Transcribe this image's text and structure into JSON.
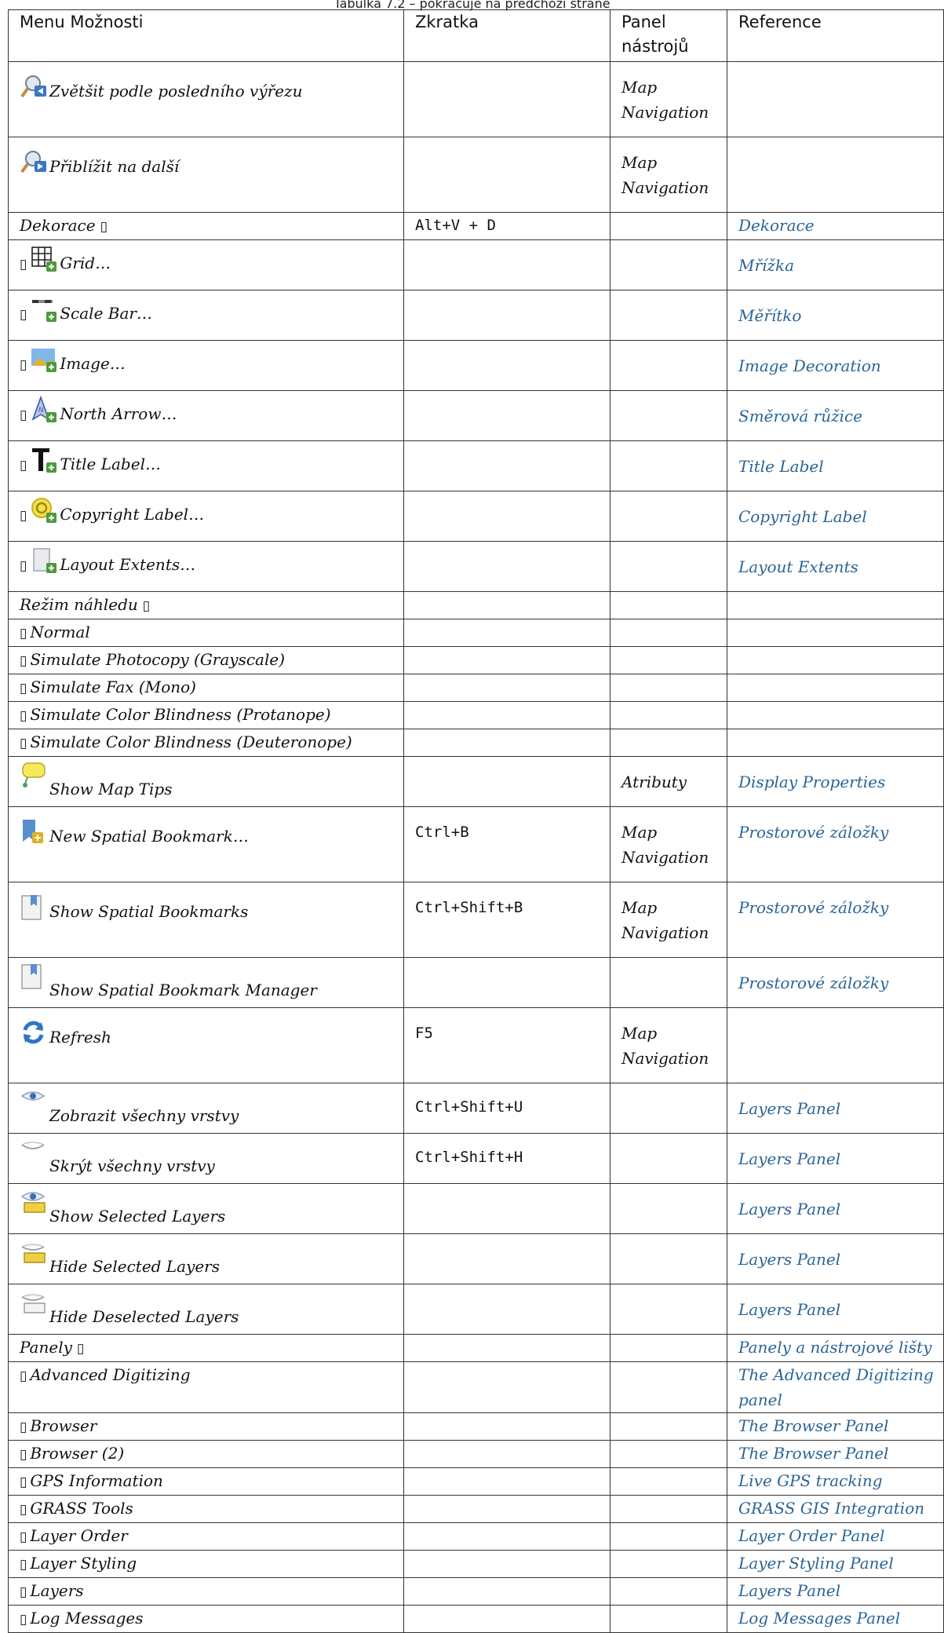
{
  "caption": "Tabulka 7.2 – pokračuje na předchozí straně",
  "headers": [
    "Menu Možnosti",
    "Zkratka",
    "Panel nástrojů",
    "Reference"
  ],
  "rows": [
    {
      "label": "Zvětšit podle posledního výřezu",
      "icon": "zoom-last-icon",
      "shortcut": "",
      "toolbar": "Map Navigation",
      "reference": ""
    },
    {
      "label": "Přiblížit na další",
      "icon": "zoom-next-icon",
      "shortcut": "",
      "toolbar": "Map Navigation",
      "reference": ""
    },
    {
      "label": "Dekorace",
      "suffix": "▯",
      "shortcut": "Alt+V + D",
      "toolbar": "",
      "reference": "Dekorace"
    },
    {
      "label": "Grid…",
      "prefix": "▯",
      "icon": "grid-add-icon",
      "shortcut": "",
      "toolbar": "",
      "reference": "Mřížka"
    },
    {
      "label": "Scale Bar…",
      "prefix": "▯",
      "icon": "scalebar-add-icon",
      "shortcut": "",
      "toolbar": "",
      "reference": "Měřítko"
    },
    {
      "label": "Image…",
      "prefix": "▯",
      "icon": "image-add-icon",
      "shortcut": "",
      "toolbar": "",
      "reference": "Image Decoration"
    },
    {
      "label": "North Arrow…",
      "prefix": "▯",
      "icon": "north-arrow-add-icon",
      "shortcut": "",
      "toolbar": "",
      "reference": "Směrová růžice"
    },
    {
      "label": "Title Label…",
      "prefix": "▯",
      "icon": "title-label-add-icon",
      "shortcut": "",
      "toolbar": "",
      "reference": "Title Label"
    },
    {
      "label": "Copyright Label…",
      "prefix": "▯",
      "icon": "copyright-add-icon",
      "shortcut": "",
      "toolbar": "",
      "reference": "Copyright Label"
    },
    {
      "label": "Layout Extents…",
      "prefix": "▯",
      "icon": "layout-extents-add-icon",
      "shortcut": "",
      "toolbar": "",
      "reference": "Layout Extents"
    },
    {
      "label": "Režim náhledu",
      "suffix": "▯",
      "shortcut": "",
      "toolbar": "",
      "reference": ""
    },
    {
      "label": "Normal",
      "prefix": "▯",
      "shortcut": "",
      "toolbar": "",
      "reference": ""
    },
    {
      "label": "Simulate Photocopy (Grayscale)",
      "prefix": "▯",
      "shortcut": "",
      "toolbar": "",
      "reference": ""
    },
    {
      "label": "Simulate Fax (Mono)",
      "prefix": "▯",
      "shortcut": "",
      "toolbar": "",
      "reference": ""
    },
    {
      "label": "Simulate Color Blindness (Protanope)",
      "prefix": "▯",
      "shortcut": "",
      "toolbar": "",
      "reference": ""
    },
    {
      "label": "Simulate Color Blindness (Deuteronope)",
      "prefix": "▯",
      "shortcut": "",
      "toolbar": "",
      "reference": ""
    },
    {
      "label": "Show Map Tips",
      "icon": "map-tips-icon",
      "shortcut": "",
      "toolbar": "Atributy",
      "reference": "Display Properties"
    },
    {
      "label": "New Spatial Bookmark…",
      "icon": "new-bookmark-icon",
      "shortcut": "Ctrl+B",
      "toolbar": "Map Navigation",
      "reference": "Prostorové záložky"
    },
    {
      "label": "Show Spatial Bookmarks",
      "icon": "bookmarks-icon",
      "shortcut": "Ctrl+Shift+B",
      "toolbar": "Map Navigation",
      "reference": "Prostorové záložky"
    },
    {
      "label": "Show Spatial Bookmark Manager",
      "icon": "bookmark-manager-icon",
      "shortcut": "",
      "toolbar": "",
      "reference": "Prostorové záložky"
    },
    {
      "label": "Refresh",
      "icon": "refresh-icon",
      "shortcut": "F5",
      "toolbar": "Map Navigation",
      "reference": ""
    },
    {
      "label": "Zobrazit všechny vrstvy",
      "icon": "show-all-layers-icon",
      "shortcut": "Ctrl+Shift+U",
      "toolbar": "",
      "reference": "Layers Panel"
    },
    {
      "label": "Skrýt všechny vrstvy",
      "icon": "hide-all-layers-icon",
      "shortcut": "Ctrl+Shift+H",
      "toolbar": "",
      "reference": "Layers Panel"
    },
    {
      "label": "Show Selected Layers",
      "icon": "show-selected-layers-icon",
      "shortcut": "",
      "toolbar": "",
      "reference": "Layers Panel"
    },
    {
      "label": "Hide Selected Layers",
      "icon": "hide-selected-layers-icon",
      "shortcut": "",
      "toolbar": "",
      "reference": "Layers Panel"
    },
    {
      "label": "Hide Deselected Layers",
      "icon": "hide-deselected-layers-icon",
      "shortcut": "",
      "toolbar": "",
      "reference": "Layers Panel"
    },
    {
      "label": "Panely",
      "suffix": "▯",
      "shortcut": "",
      "toolbar": "",
      "reference": "Panely a nástrojové lišty"
    },
    {
      "label": "Advanced Digitizing",
      "prefix": "▯",
      "shortcut": "",
      "toolbar": "",
      "reference": "The Advanced Digitizing panel"
    },
    {
      "label": "Browser",
      "prefix": "▯",
      "shortcut": "",
      "toolbar": "",
      "reference": "The Browser Panel"
    },
    {
      "label": "Browser (2)",
      "prefix": "▯",
      "shortcut": "",
      "toolbar": "",
      "reference": "The Browser Panel"
    },
    {
      "label": "GPS Information",
      "prefix": "▯",
      "shortcut": "",
      "toolbar": "",
      "reference": "Live GPS tracking"
    },
    {
      "label": "GRASS Tools",
      "prefix": "▯",
      "shortcut": "",
      "toolbar": "",
      "reference": "GRASS GIS Integration"
    },
    {
      "label": "Layer Order",
      "prefix": "▯",
      "shortcut": "",
      "toolbar": "",
      "reference": "Layer Order Panel"
    },
    {
      "label": "Layer Styling",
      "prefix": "▯",
      "shortcut": "",
      "toolbar": "",
      "reference": "Layer Styling Panel"
    },
    {
      "label": "Layers",
      "prefix": "▯",
      "shortcut": "",
      "toolbar": "",
      "reference": "Layers Panel"
    },
    {
      "label": "Log Messages",
      "prefix": "▯",
      "shortcut": "",
      "toolbar": "",
      "reference": "Log Messages Panel"
    }
  ]
}
